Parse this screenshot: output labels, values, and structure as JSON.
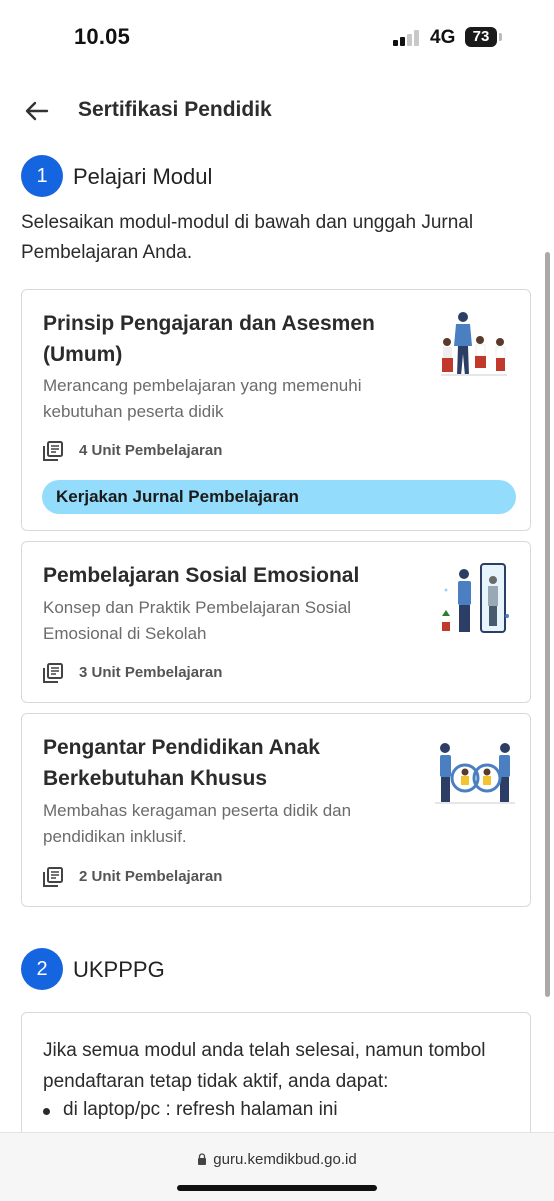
{
  "status": {
    "time": "10.05",
    "network": "4G",
    "battery": "73"
  },
  "header": {
    "title": "Sertifikasi Pendidik"
  },
  "step1": {
    "number": "1",
    "title": "Pelajari Modul",
    "intro": "Selesaikan modul-modul di bawah dan unggah Jurnal Pembelajaran Anda."
  },
  "modules": [
    {
      "title": "Prinsip Pengajaran dan Asesmen (Umum)",
      "description": "Merancang pembelajaran yang memenuhi kebutuhan peserta didik",
      "units": "4 Unit Pembelajaran",
      "action": "Kerjakan Jurnal Pembelajaran"
    },
    {
      "title": "Pembelajaran Sosial Emosional",
      "description": "Konsep dan Praktik Pembelajaran Sosial Emosional di Sekolah",
      "units": "3 Unit Pembelajaran"
    },
    {
      "title": "Pengantar Pendidikan Anak Berkebutuhan Khusus",
      "description": "Membahas keragaman peserta didik dan pendidikan inklusif.",
      "units": "2 Unit Pembelajaran"
    }
  ],
  "step2": {
    "number": "2",
    "title": "UKPPPG",
    "text": "Jika semua modul anda telah selesai, namun tombol pendaftaran tetap tidak aktif, anda dapat:",
    "bullets": [
      "di laptop/pc : refresh halaman ini"
    ]
  },
  "browser": {
    "url": "guru.kemdikbud.go.id"
  },
  "colors": {
    "step_circle": "#1565e0",
    "action_button": "#94dcfb"
  }
}
